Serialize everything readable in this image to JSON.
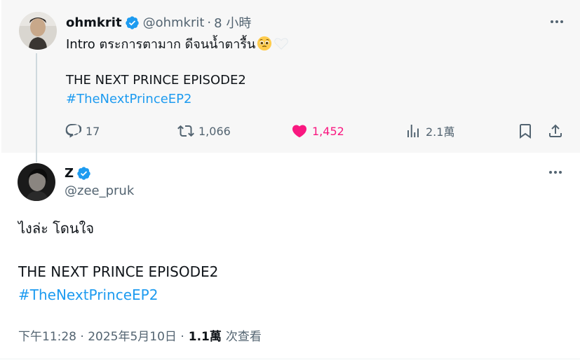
{
  "parent_tweet": {
    "author_name": "ohmkrit",
    "handle": "@ohmkrit",
    "separator": "·",
    "time_ago": "8 小時",
    "text_line1": "Intro ตระการตามาก ดีจนน้ำตารื้น",
    "emojis": [
      "pleading-face-emoji",
      "white-heart-emoji"
    ],
    "text_line2": "THE NEXT PRINCE EPISODE2",
    "hashtag": "#TheNextPrinceEP2",
    "replies": "17",
    "reposts": "1,066",
    "likes": "1,452",
    "views": "2.1萬",
    "liked": true
  },
  "main_tweet": {
    "author_name": "Z",
    "handle": "@zee_pruk",
    "text_line1": "ไงล่ะ โดนใจ",
    "text_line2": "THE NEXT PRINCE EPISODE2",
    "hashtag": "#TheNextPrinceEP2",
    "timestamp": "下午11:28 · 2025年5月10日 ·",
    "views_count": "1.1萬",
    "views_label": "次查看"
  },
  "colors": {
    "accent": "#1d9bf0",
    "like": "#f91880",
    "secondary_text": "#536471",
    "parent_bg": "#f7f7f7"
  }
}
